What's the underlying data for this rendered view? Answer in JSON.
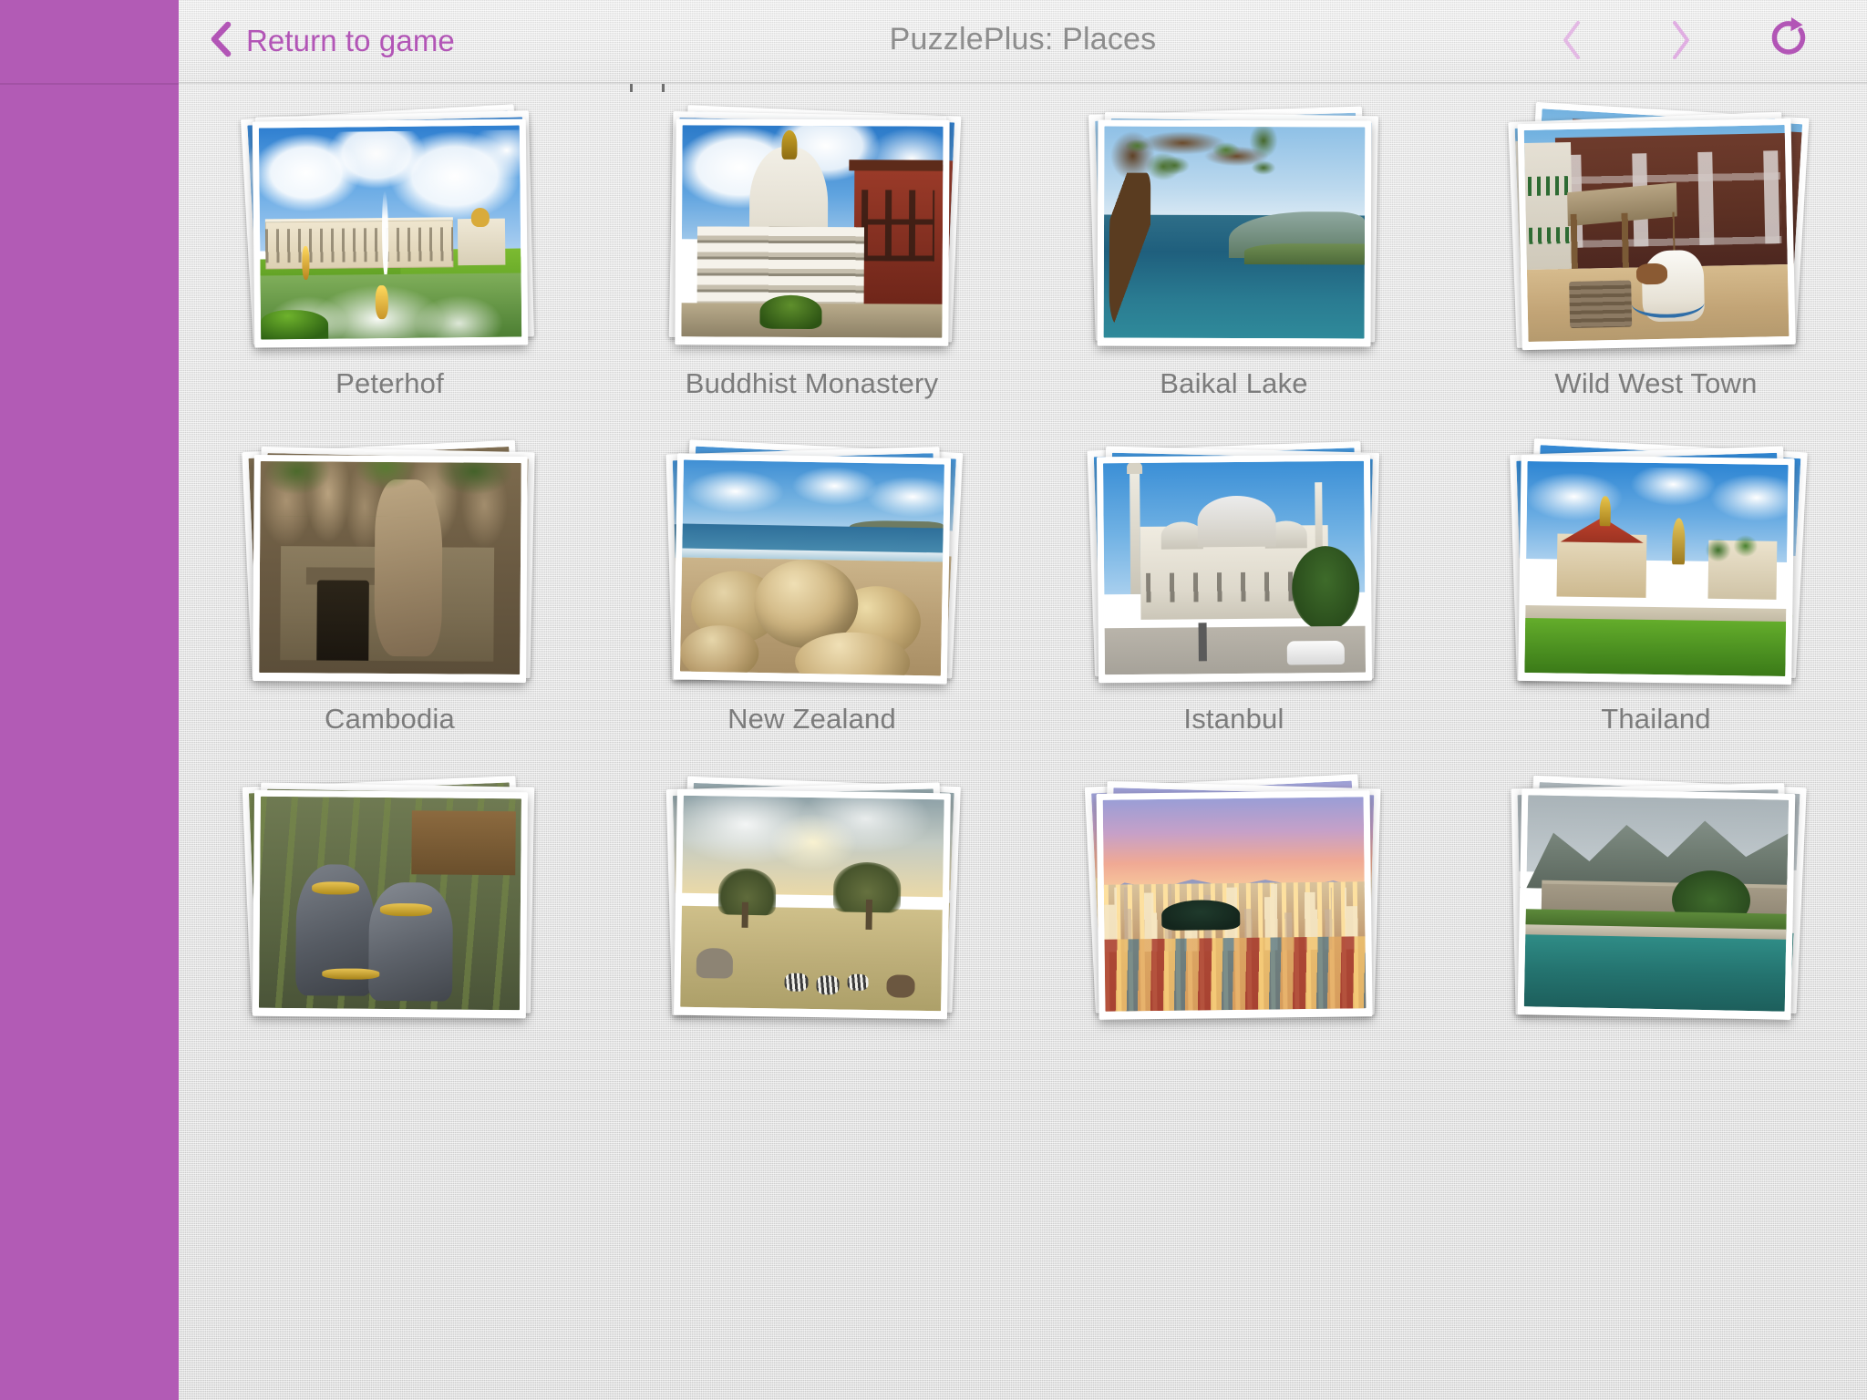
{
  "app": {
    "title": "PuzzlePlus: Places"
  },
  "sidebar": {
    "name": "game-sidebar",
    "color": "#b25bb5"
  },
  "header": {
    "back_button_label": "Return to game",
    "title": "PuzzlePlus: Places",
    "back_icon": "chevron-left-icon",
    "prev_icon": "chevron-left-icon",
    "next_icon": "chevron-right-icon",
    "refresh_icon": "refresh-icon",
    "accent_color": "#b255b6",
    "accent_disabled_color": "#e3b9e4",
    "title_color": "#8d8d8d"
  },
  "gallery": {
    "caption_color": "#7c7c7c",
    "rows": [
      {
        "items": [
          {
            "caption": "Peterhof",
            "scene": "peterhof",
            "stack_rotations": [
              -3.2,
              -1.4,
              -0.6
            ]
          },
          {
            "caption": "Buddhist Monastery",
            "scene": "monastery",
            "stack_rotations": [
              2.4,
              1.1,
              0.3
            ]
          },
          {
            "caption": "Baikal Lake",
            "scene": "baikal",
            "stack_rotations": [
              -1.8,
              0.9,
              0.2
            ]
          },
          {
            "caption": "Wild West Town",
            "scene": "wildwest",
            "stack_rotations": [
              3.4,
              -2.2,
              -1.2
            ]
          }
        ]
      },
      {
        "items": [
          {
            "caption": "Cambodia",
            "scene": "cambodia",
            "stack_rotations": [
              -2.6,
              1.2,
              0.4
            ]
          },
          {
            "caption": "New Zealand",
            "scene": "newzealand",
            "stack_rotations": [
              2.8,
              -1.6,
              1.0
            ]
          },
          {
            "caption": "Istanbul",
            "scene": "istanbul",
            "stack_rotations": [
              -2.0,
              1.4,
              -0.5
            ]
          },
          {
            "caption": "Thailand",
            "scene": "thailand",
            "stack_rotations": [
              3.0,
              -1.8,
              0.8
            ]
          }
        ]
      },
      {
        "items": [
          {
            "caption": "",
            "scene": "india",
            "stack_rotations": [
              -2.4,
              1.0,
              0.5
            ]
          },
          {
            "caption": "",
            "scene": "africa",
            "stack_rotations": [
              2.2,
              -1.5,
              0.9
            ]
          },
          {
            "caption": "",
            "scene": "brazil",
            "stack_rotations": [
              -2.8,
              1.6,
              -0.7
            ]
          },
          {
            "caption": "",
            "scene": "montenegro",
            "stack_rotations": [
              2.6,
              -1.2,
              1.1
            ]
          }
        ]
      }
    ]
  }
}
